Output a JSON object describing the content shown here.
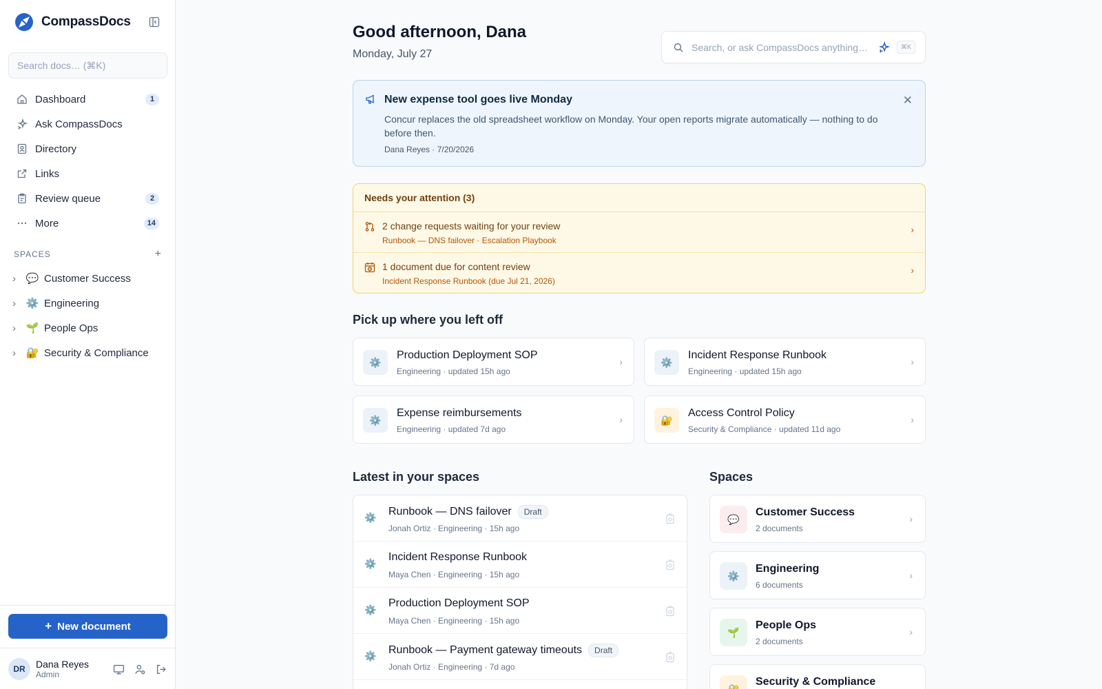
{
  "brand": {
    "name": "CompassDocs"
  },
  "sidebar": {
    "search_placeholder": "Search docs… (⌘K)",
    "nav": [
      {
        "label": "Dashboard",
        "badge": "1",
        "icon": "home-icon"
      },
      {
        "label": "Ask CompassDocs",
        "badge": "",
        "icon": "sparkles-icon"
      },
      {
        "label": "Directory",
        "badge": "",
        "icon": "contact-book-icon"
      },
      {
        "label": "Links",
        "badge": "",
        "icon": "external-link-icon"
      },
      {
        "label": "Review queue",
        "badge": "2",
        "icon": "clipboard-icon"
      },
      {
        "label": "More",
        "badge": "14",
        "icon": "ellipsis-icon"
      }
    ],
    "spaces_heading": "SPACES",
    "spaces": [
      {
        "label": "Customer Success",
        "emoji": "💬"
      },
      {
        "label": "Engineering",
        "emoji": "⚙️"
      },
      {
        "label": "People Ops",
        "emoji": "🌱"
      },
      {
        "label": "Security & Compliance",
        "emoji": "🔐"
      }
    ],
    "new_document": "New document",
    "user": {
      "initials": "DR",
      "name": "Dana Reyes",
      "role": "Admin"
    }
  },
  "header": {
    "greeting": "Good afternoon, Dana",
    "date": "Monday, July 27",
    "search_placeholder": "Search, or ask CompassDocs anything…",
    "shortcut": "⌘K"
  },
  "announcement": {
    "title": "New expense tool goes live Monday",
    "body": "Concur replaces the old spreadsheet workflow on Monday. Your open reports migrate automatically — nothing to do before then.",
    "meta": "Dana Reyes · 7/20/2026"
  },
  "attention": {
    "title": "Needs your attention (3)",
    "items": [
      {
        "title": "2 change requests waiting for your review",
        "sub": "Runbook — DNS failover · Escalation Playbook"
      },
      {
        "title": "1 document due for content review",
        "sub": "Incident Response Runbook (due Jul 21, 2026)"
      }
    ]
  },
  "recent": {
    "title": "Pick up where you left off",
    "items": [
      {
        "title": "Production Deployment SOP",
        "sub": "Engineering · updated 15h ago",
        "emoji": "⚙️"
      },
      {
        "title": "Incident Response Runbook",
        "sub": "Engineering · updated 15h ago",
        "emoji": "⚙️"
      },
      {
        "title": "Expense reimbursements",
        "sub": "Engineering · updated 7d ago",
        "emoji": "⚙️"
      },
      {
        "title": "Access Control Policy",
        "sub": "Security & Compliance · updated 11d ago",
        "emoji": "🔐"
      }
    ]
  },
  "latest": {
    "title": "Latest in your spaces",
    "items": [
      {
        "title": "Runbook — DNS failover",
        "badge": "Draft",
        "sub": "Jonah Ortiz · Engineering · 15h ago"
      },
      {
        "title": "Incident Response Runbook",
        "badge": "",
        "sub": "Maya Chen · Engineering · 15h ago"
      },
      {
        "title": "Production Deployment SOP",
        "badge": "",
        "sub": "Maya Chen · Engineering · 15h ago"
      },
      {
        "title": "Runbook — Payment gateway timeouts",
        "badge": "Draft",
        "sub": "Jonah Ortiz · Engineering · 7d ago"
      }
    ]
  },
  "spaces_panel": {
    "title": "Spaces",
    "items": [
      {
        "title": "Customer Success",
        "sub": "2 documents",
        "emoji": "💬",
        "bg": "#fdecef"
      },
      {
        "title": "Engineering",
        "sub": "6 documents",
        "emoji": "⚙️",
        "bg": "#edf2f9"
      },
      {
        "title": "People Ops",
        "sub": "2 documents",
        "emoji": "🌱",
        "bg": "#e7f6ea"
      },
      {
        "title": "Security & Compliance",
        "sub": "",
        "emoji": "🔐",
        "bg": "#fff3df"
      }
    ]
  },
  "colors": {
    "accent": "#2563c9",
    "announcement_bg": "#eef5fc",
    "attention_bg": "#fef9e6",
    "attention_text": "#713f12"
  }
}
